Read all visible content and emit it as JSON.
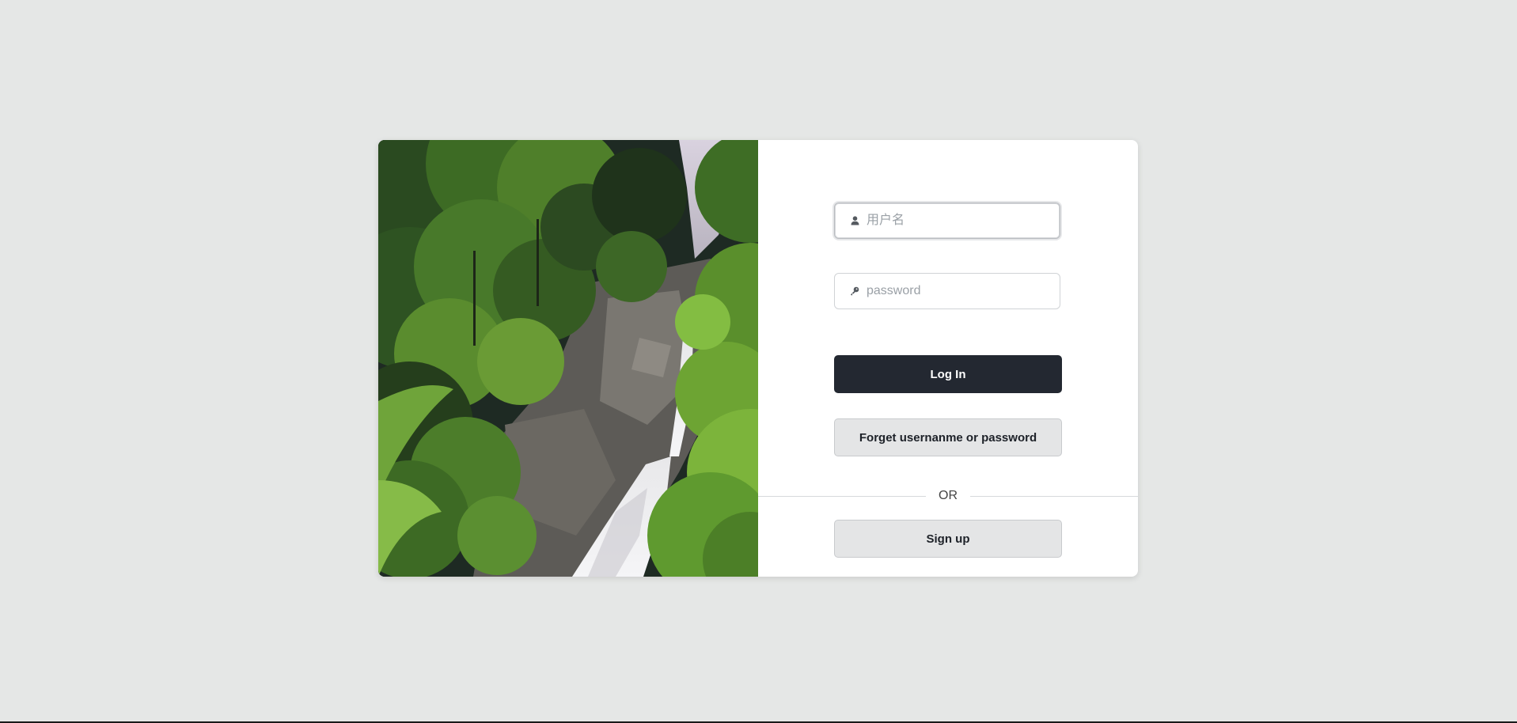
{
  "login": {
    "username_placeholder": "用户名",
    "username_value": "",
    "password_placeholder": "password",
    "password_value": "",
    "login_label": "Log In",
    "forgot_label": "Forget usernanme or password",
    "divider_text": "OR",
    "signup_label": "Sign up"
  },
  "icons": {
    "username": "user-icon",
    "password": "key-icon"
  },
  "colors": {
    "background": "#e5e7e6",
    "primary_button": "#232831",
    "secondary_button": "#e4e5e6"
  }
}
